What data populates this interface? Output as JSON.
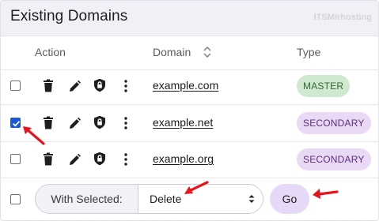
{
  "header": {
    "title": "Existing Domains",
    "watermark": "ITSMirhosting"
  },
  "columns": {
    "action": "Action",
    "domain": "Domain",
    "type": "Type"
  },
  "rows": [
    {
      "domain": "example.com",
      "type": "MASTER",
      "checked": false
    },
    {
      "domain": "example.net",
      "type": "SECONDARY",
      "checked": true
    },
    {
      "domain": "example.org",
      "type": "SECONDARY",
      "checked": false
    }
  ],
  "row_icons": [
    "trash-icon",
    "pencil-icon",
    "shield-icon",
    "more-vertical-icon"
  ],
  "bulk": {
    "label": "With Selected:",
    "selected": "Delete",
    "go_label": "Go"
  },
  "colors": {
    "header_bg": "#f3eff7",
    "checkbox_checked": "#1a57d6",
    "badge_master_bg": "#cfe8cf",
    "badge_secondary_bg": "#ead9f5",
    "go_bg": "#e6d9f7",
    "annotation_arrow": "#e8141c"
  }
}
